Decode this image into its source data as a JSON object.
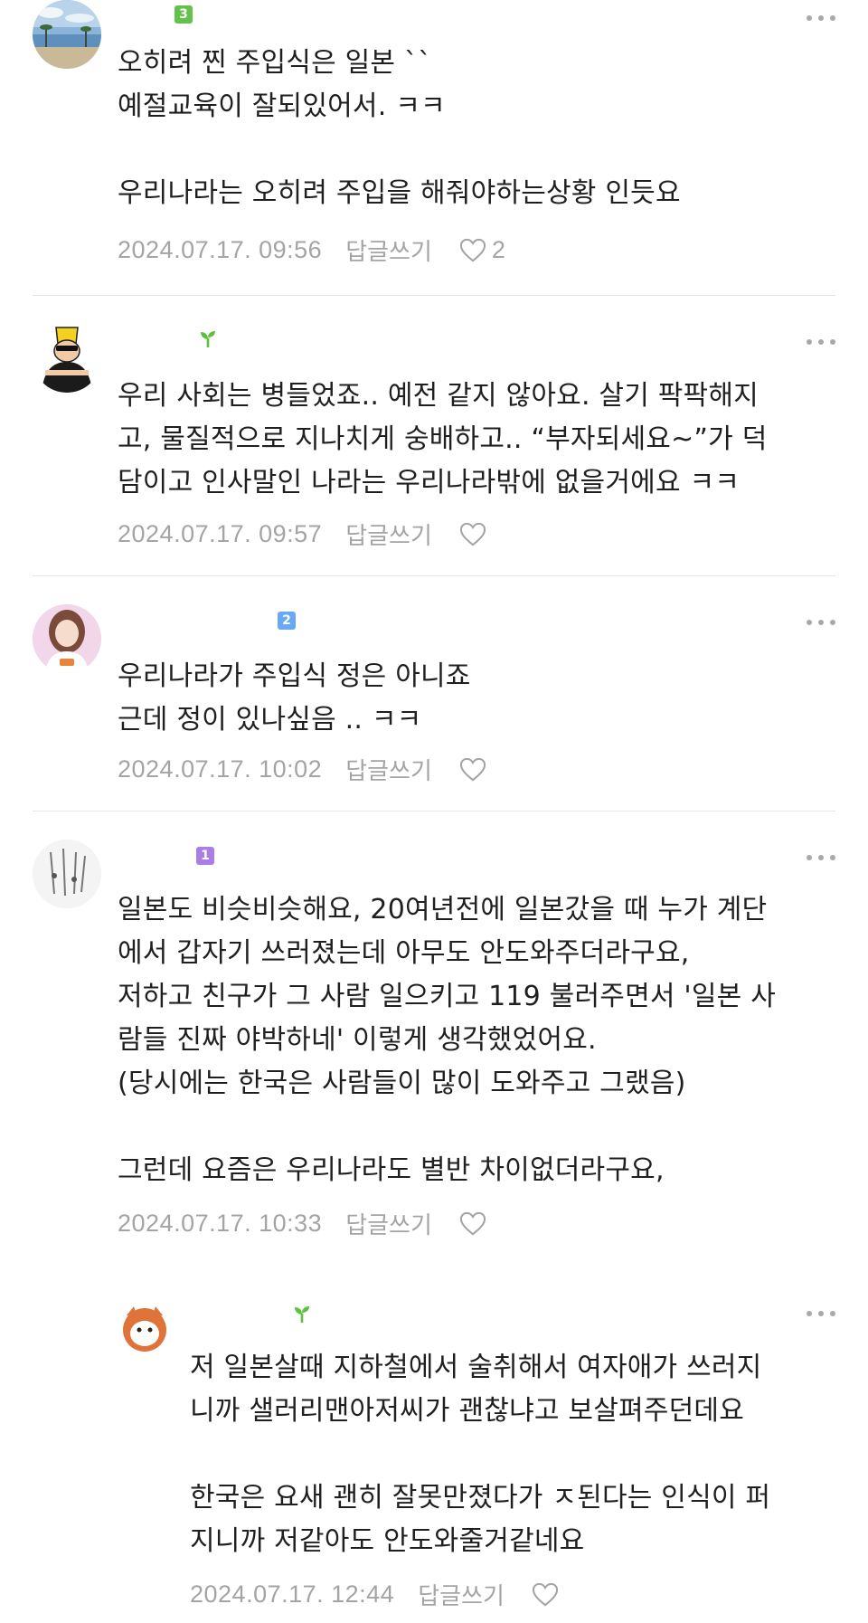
{
  "comments": [
    {
      "body": "오히려 찐 주입식은 일본 ``\n예절교육이 잘되있어서. ㅋㅋ\n\n우리나라는 오히려 주입을 해줘야하는상황 인듯요",
      "date": "2024.07.17. 09:56",
      "reply": "답글쓰기",
      "likes": "2",
      "badge": "3",
      "badge_color": "#63c24b"
    },
    {
      "body": "우리 사회는 병들었죠.. 예전 같지 않아요. 살기 팍팍해지\n고, 물질적으로 지나치게 숭배하고.. “부자되세요~”가 덕\n담이고 인사말인 나라는 우리나라밖에 없을거에요 ㅋㅋ",
      "date": "2024.07.17. 09:57",
      "reply": "답글쓰기",
      "badge": "sprout",
      "badge_color": "#5cc13c"
    },
    {
      "body": "우리나라가 주입식 정은 아니죠\n근데 정이 있나싶음 .. ㅋㅋ",
      "date": "2024.07.17. 10:02",
      "reply": "답글쓰기",
      "badge": "2",
      "badge_color": "#6aa8f5"
    },
    {
      "body": "일본도 비슷비슷해요, 20여년전에 일본갔을 때 누가 계단\n에서 갑자기 쓰러졌는데 아무도 안도와주더라구요,\n저하고 친구가 그 사람 일으키고 119 불러주면서 '일본 사\n람들 진짜 야박하네' 이렇게 생각했었어요.\n(당시에는 한국은 사람들이 많이 도와주고 그랬음)\n\n그런데 요즘은 우리나라도 별반 차이없더라구요,",
      "date": "2024.07.17. 10:33",
      "reply": "답글쓰기",
      "badge": "1",
      "badge_color": "#a97ee6"
    },
    {
      "body": "저 일본살때 지하철에서 술취해서 여자애가 쓰러지\n니까 샐러리맨아저씨가 괜찮냐고 보살펴주던데요\n\n한국은 요새 괜히 잘못만졌다가 ㅈ된다는 인식이 퍼\n지니까 저같아도 안도와줄거같네요",
      "date": "2024.07.17. 12:44",
      "reply": "답글쓰기",
      "badge": "sprout",
      "badge_color": "#5cc13c"
    }
  ],
  "icons": {
    "more": "more-dots-icon",
    "like": "heart-outline-icon",
    "sprout": "sprout-icon"
  },
  "colors": {
    "meta_gray": "#a4a4a4",
    "text": "#1f1f1f",
    "divider": "#e6e6e6"
  }
}
